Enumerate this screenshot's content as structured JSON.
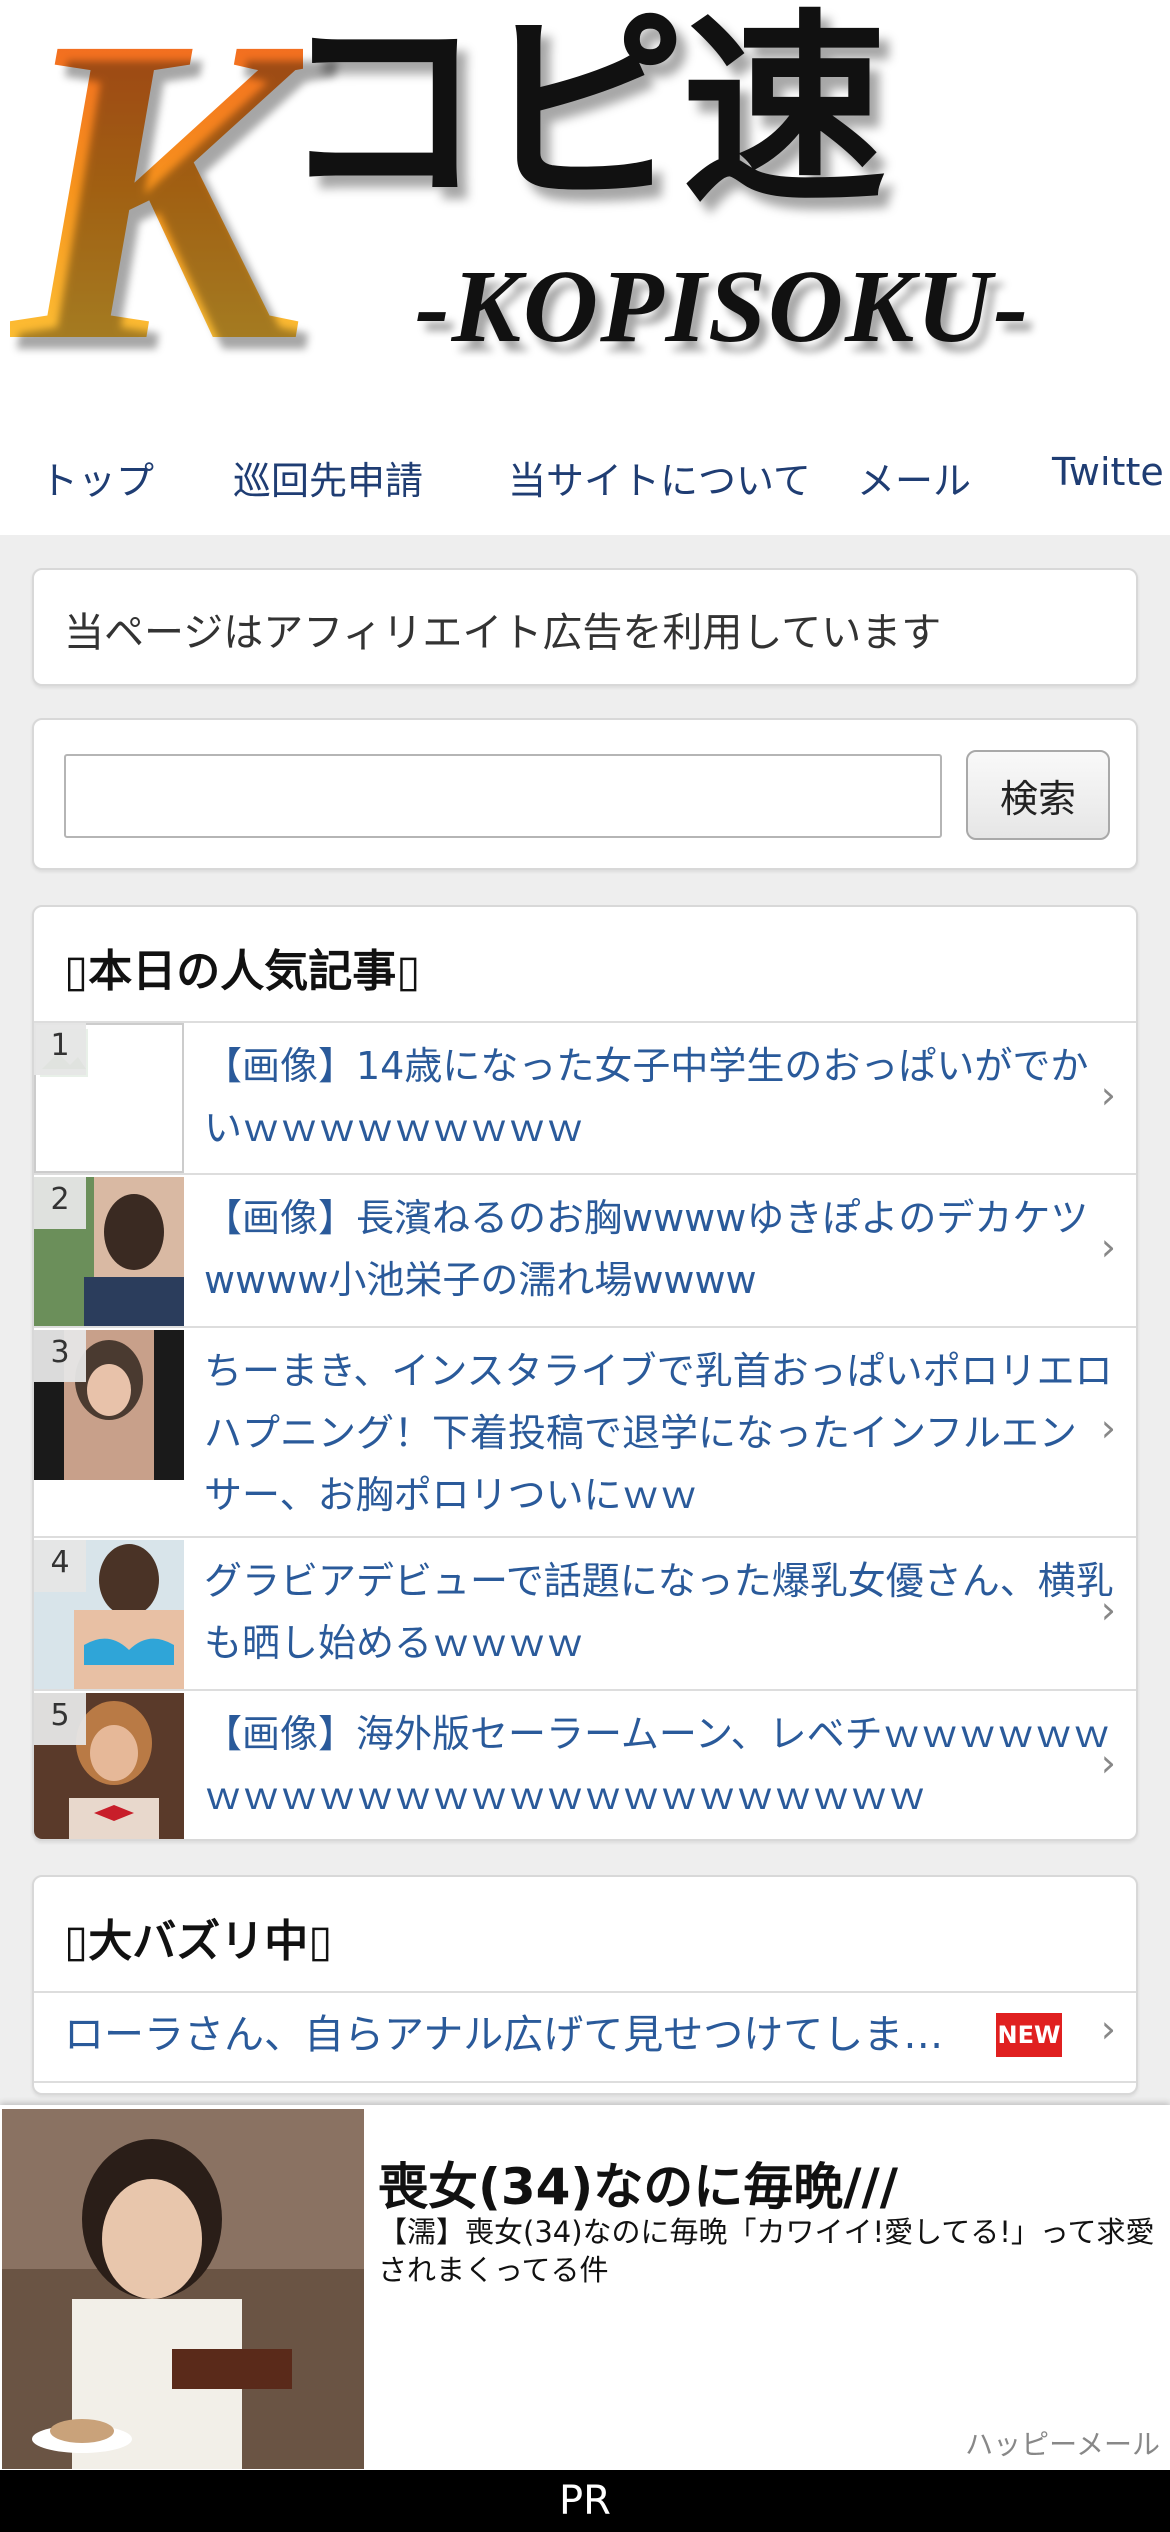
{
  "logo": {
    "letter": "K",
    "kana": "コピ速",
    "sub": "-KOPISOKU-"
  },
  "nav": {
    "items": [
      {
        "label": "トップ"
      },
      {
        "label": "巡回先申請"
      },
      {
        "label": "当サイトについて"
      },
      {
        "label": "メール"
      },
      {
        "label": "Twitte"
      }
    ]
  },
  "notice": {
    "text": "当ページはアフィリエイト広告を利用しています"
  },
  "search": {
    "value": "",
    "button_label": "検索"
  },
  "ranking": {
    "title": "本日の人気記事",
    "items": [
      {
        "rank": "1",
        "title": "【画像】14歳になった女子中学生のおっぱいがでかいｗｗｗｗｗｗｗｗｗ"
      },
      {
        "rank": "2",
        "title": "【画像】長濱ねるのお胸wwwwゆきぽよのデカケツwwww小池栄子の濡れ場wwww"
      },
      {
        "rank": "3",
        "title": "ちーまき、インスタライブで乳首おっぱいポロリエロハプニング！下着投稿で退学になったインフルエンサー、お胸ポロリついにｗｗ"
      },
      {
        "rank": "4",
        "title": "グラビアデビューで話題になった爆乳女優さん、横乳も晒し始めるｗｗｗｗ"
      },
      {
        "rank": "5",
        "title": "【画像】海外版セーラームーン、レベチｗｗｗｗｗｗｗｗｗｗｗｗｗｗｗｗｗｗｗｗｗｗｗｗｗ"
      }
    ]
  },
  "buzz": {
    "title": "大バズリ中",
    "items": [
      {
        "title": "ローラさん、自らアナル広げて見せつけてしま…",
        "badge": "NEW"
      }
    ]
  },
  "ad": {
    "headline": "喪女(34)なのに毎晩///",
    "body": "【濡】喪女(34)なのに毎晩「カワイイ!愛してる!」って求愛されまくってる件",
    "source": "ハッピーメール",
    "pr_label": "PR"
  },
  "icons": {
    "chevron": "chevron-right-icon"
  }
}
